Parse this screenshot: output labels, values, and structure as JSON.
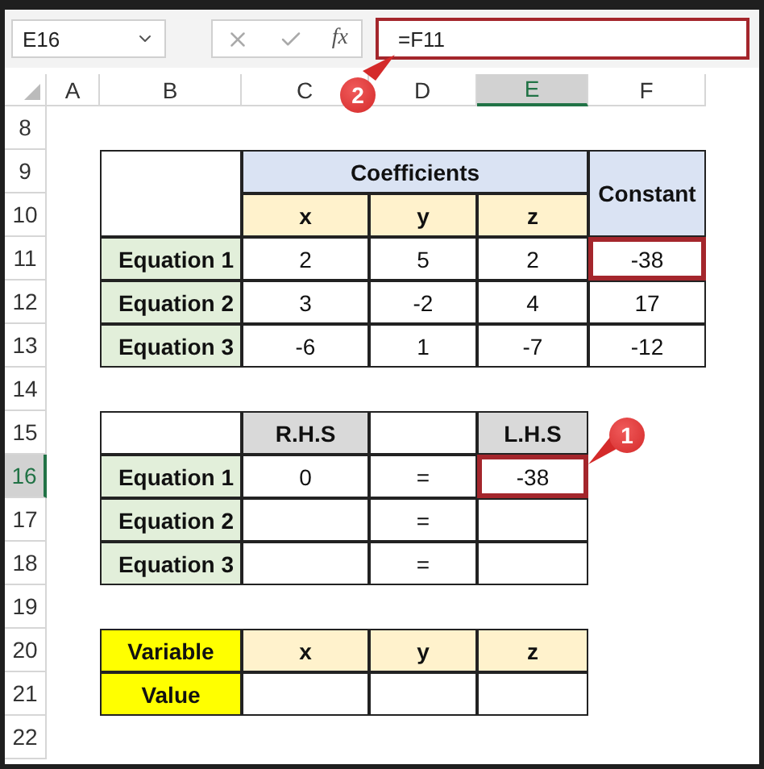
{
  "name_box": "E16",
  "function_label": "fx",
  "formula": "=F11",
  "column_headers": [
    {
      "label": "A",
      "selected": false
    },
    {
      "label": "B",
      "selected": false
    },
    {
      "label": "C",
      "selected": false
    },
    {
      "label": "D",
      "selected": false
    },
    {
      "label": "E",
      "selected": true
    },
    {
      "label": "F",
      "selected": false
    }
  ],
  "row_headers": [
    {
      "label": "8",
      "selected": false
    },
    {
      "label": "9",
      "selected": false
    },
    {
      "label": "10",
      "selected": false
    },
    {
      "label": "11",
      "selected": false
    },
    {
      "label": "12",
      "selected": false
    },
    {
      "label": "13",
      "selected": false
    },
    {
      "label": "14",
      "selected": false
    },
    {
      "label": "15",
      "selected": false
    },
    {
      "label": "16",
      "selected": true
    },
    {
      "label": "17",
      "selected": false
    },
    {
      "label": "18",
      "selected": false
    },
    {
      "label": "19",
      "selected": false
    },
    {
      "label": "20",
      "selected": false
    },
    {
      "label": "21",
      "selected": false
    },
    {
      "label": "22",
      "selected": false
    }
  ],
  "coefficients_table": {
    "group_header": "Coefficients",
    "constant_header": "Constant",
    "variables": [
      "x",
      "y",
      "z"
    ],
    "rows": [
      {
        "label": "Equation 1",
        "values": [
          "2",
          "5",
          "2"
        ],
        "constant": "-38",
        "highlighted": true
      },
      {
        "label": "Equation 2",
        "values": [
          "3",
          "-2",
          "4"
        ],
        "constant": "17",
        "highlighted": false
      },
      {
        "label": "Equation 3",
        "values": [
          "-6",
          "1",
          "-7"
        ],
        "constant": "-12",
        "highlighted": false
      }
    ]
  },
  "check_table": {
    "rhs_header": "R.H.S",
    "lhs_header": "L.H.S",
    "rows": [
      {
        "label": "Equation 1",
        "rhs": "0",
        "sign": "=",
        "lhs": "-38",
        "highlighted": true
      },
      {
        "label": "Equation 2",
        "sign": "=",
        "highlighted": false
      },
      {
        "label": "Equation 3",
        "sign": "=",
        "highlighted": false
      }
    ]
  },
  "variable_table": {
    "variable_label": "Variable",
    "value_label": "Value",
    "variables": [
      "x",
      "y",
      "z"
    ]
  },
  "callouts": [
    {
      "number": "1",
      "kind": "cell"
    },
    {
      "number": "2",
      "kind": "formula"
    }
  ]
}
